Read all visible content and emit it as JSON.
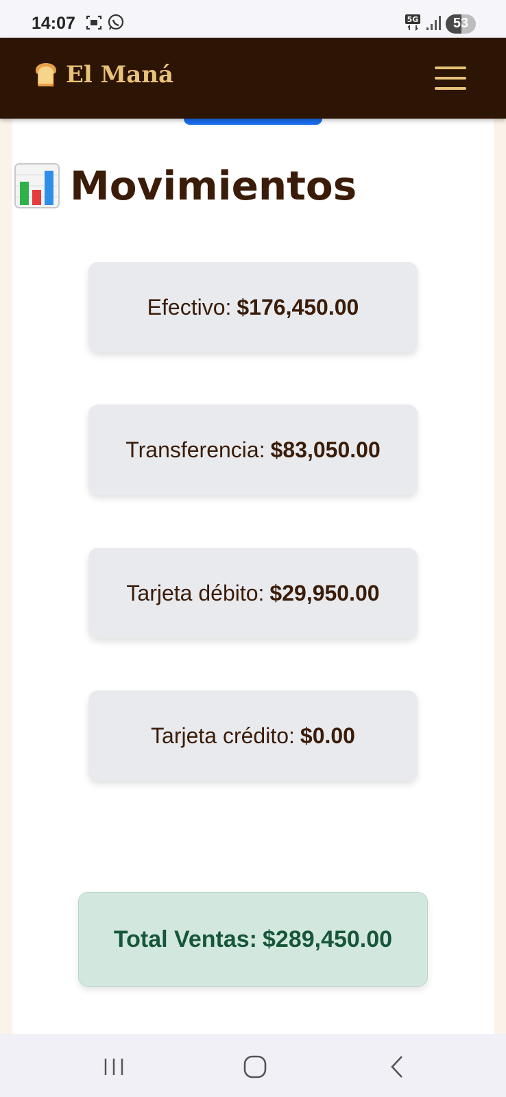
{
  "status_bar": {
    "time": "14:07",
    "battery": "53",
    "battery_level_percent": 53,
    "icons": [
      "screenshot-icon",
      "whatsapp-icon",
      "5g-icon",
      "signal-icon",
      "battery-icon"
    ]
  },
  "header": {
    "brand_emoji": "bread-icon",
    "brand_name": "El Maná",
    "menu_icon": "hamburger-menu-icon",
    "background_color": "#2c1505",
    "brand_color": "#e8c27a"
  },
  "page": {
    "title_icon": "bar-chart-icon",
    "title": "Movimientos"
  },
  "movements": [
    {
      "label": "Efectivo:",
      "amount": "$176,450.00"
    },
    {
      "label": "Transferencia:",
      "amount": "$83,050.00"
    },
    {
      "label": "Tarjeta débito:",
      "amount": "$29,950.00"
    },
    {
      "label": "Tarjeta crédito:",
      "amount": "$0.00"
    }
  ],
  "total": {
    "label": "Total Ventas:",
    "amount": "$289,450.00",
    "color": "#17563a",
    "background": "#d2e8de"
  },
  "system_nav": {
    "buttons": [
      "recent-apps-icon",
      "home-icon",
      "back-icon"
    ]
  }
}
